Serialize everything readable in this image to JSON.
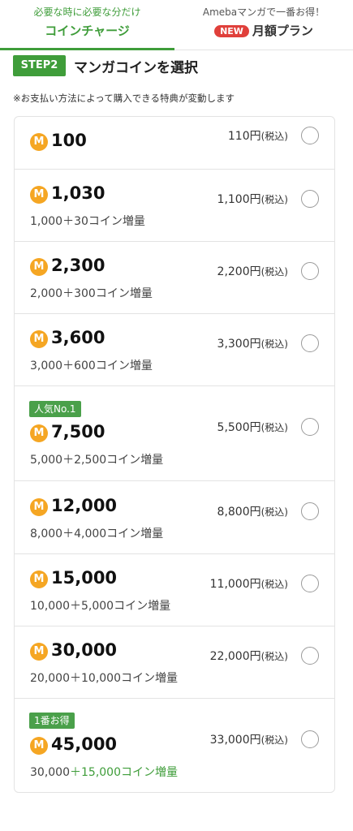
{
  "tabs": {
    "coin": {
      "sub": "必要な時に必要な分だけ",
      "label": "コインチャージ"
    },
    "monthly": {
      "sub": "Amebaマンガで一番お得！",
      "badge": "NEW",
      "label": "月額プラン"
    }
  },
  "step": {
    "badge": "STEP2",
    "title": "マンガコインを選択"
  },
  "notice": "※お支払い方法によって購入できる特典が変動します",
  "coin_icon": "M",
  "tax_label": "(税込)",
  "colors": {
    "accent": "#3f9d3a",
    "coin": "#f5a623",
    "new_badge": "#e0403b"
  },
  "items": [
    {
      "amount": "100",
      "price": "110円",
      "bonus_base": "",
      "bonus_extra": ""
    },
    {
      "amount": "1,030",
      "price": "1,100円",
      "bonus_base": "1,000",
      "bonus_extra": "＋30コイン増量"
    },
    {
      "amount": "2,300",
      "price": "2,200円",
      "bonus_base": "2,000",
      "bonus_extra": "＋300コイン増量"
    },
    {
      "amount": "3,600",
      "price": "3,300円",
      "bonus_base": "3,000",
      "bonus_extra": "＋600コイン増量"
    },
    {
      "amount": "7,500",
      "price": "5,500円",
      "bonus_base": "5,000",
      "bonus_extra": "＋2,500コイン増量",
      "tag": "人気No.1"
    },
    {
      "amount": "12,000",
      "price": "8,800円",
      "bonus_base": "8,000",
      "bonus_extra": "＋4,000コイン増量"
    },
    {
      "amount": "15,000",
      "price": "11,000円",
      "bonus_base": "10,000",
      "bonus_extra": "＋5,000コイン増量"
    },
    {
      "amount": "30,000",
      "price": "22,000円",
      "bonus_base": "20,000",
      "bonus_extra": "＋10,000コイン増量"
    },
    {
      "amount": "45,000",
      "price": "33,000円",
      "bonus_base": "30,000",
      "bonus_extra": "＋15,000コイン増量",
      "tag": "1番お得"
    }
  ]
}
